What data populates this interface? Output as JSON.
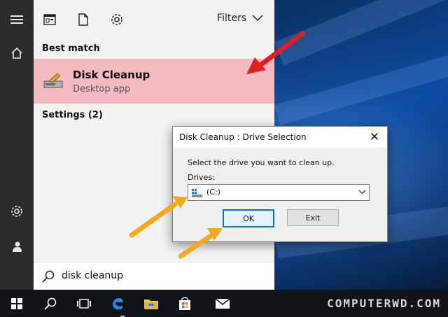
{
  "search_panel": {
    "toolbar": {
      "filters_label": "Filters"
    },
    "best_match_label": "Best match",
    "result": {
      "title": "Disk Cleanup",
      "subtitle": "Desktop app"
    },
    "settings_label": "Settings (2)",
    "search_query": "disk cleanup"
  },
  "dialog": {
    "title": "Disk Cleanup : Drive Selection",
    "prompt": "Select the drive you want to clean up.",
    "drives_label": "Drives:",
    "selected_drive": "(C:)",
    "ok_label": "OK",
    "exit_label": "Exit",
    "close_glyph": "✕"
  },
  "watermark": "COMPUTERWD.COM",
  "colors": {
    "highlight": "#f5b9c0",
    "accent": "#0078d7",
    "arrow_red": "#e02020",
    "arrow_yellow": "#f5a81c"
  },
  "icons": {
    "rail": [
      "hamburger-icon",
      "home-icon",
      "settings-icon",
      "user-icon"
    ],
    "toolbar": [
      "apps-icon",
      "documents-icon",
      "settings-icon"
    ],
    "taskbar": [
      "windows-start-icon",
      "search-icon",
      "task-view-icon",
      "edge-icon",
      "file-explorer-icon",
      "store-icon",
      "mail-icon"
    ]
  }
}
